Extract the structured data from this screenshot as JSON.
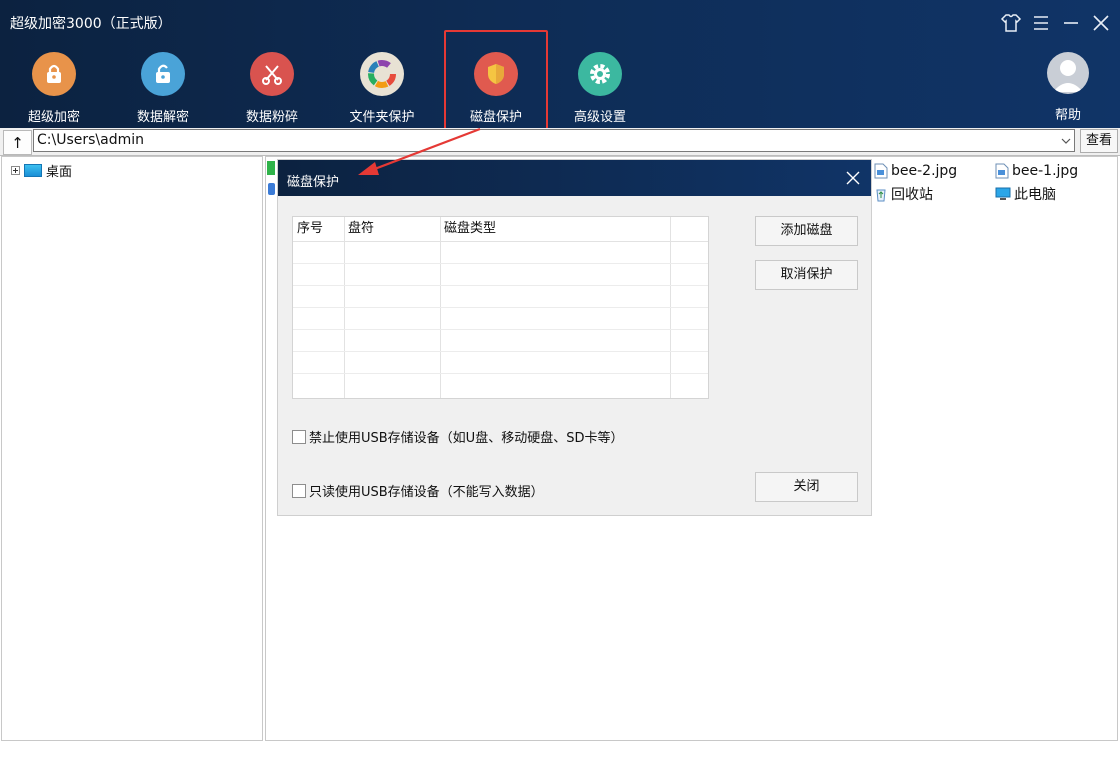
{
  "app": {
    "title": "超级加密3000（正式版）"
  },
  "toolbar": {
    "items": [
      {
        "label": "超级加密"
      },
      {
        "label": "数据解密"
      },
      {
        "label": "数据粉碎"
      },
      {
        "label": "文件夹保护"
      },
      {
        "label": "磁盘保护"
      },
      {
        "label": "高级设置"
      }
    ],
    "help_label": "帮助",
    "active": "磁盘保护"
  },
  "icons": {
    "encrypt": "lock-icon",
    "decrypt": "unlock-icon",
    "shred": "scissors-icon",
    "folder_protect": "color-wheel-icon",
    "disk_protect": "shield-icon",
    "settings": "gear-icon",
    "help": "avatar-icon"
  },
  "colors": {
    "header_bg": "#0e2c55",
    "highlight_border": "#e53935",
    "encrypt": "#e8934a",
    "decrypt": "#4aa3d8",
    "shred": "#d9534f",
    "folder_protect": "#e8e2d4",
    "disk_protect": "#e05a4f",
    "settings": "#3cb8a0"
  },
  "pathbar": {
    "up_label": "↑",
    "path": "C:\\Users\\admin",
    "view_label": "查看"
  },
  "tree": {
    "root_label": "桌面"
  },
  "files": [
    {
      "name": "bee-2.jpg",
      "icon": "image-file-icon"
    },
    {
      "name": "bee-1.jpg",
      "icon": "image-file-icon"
    },
    {
      "name": "回收站",
      "icon": "recycle-bin-icon"
    },
    {
      "name": "此电脑",
      "icon": "computer-icon"
    }
  ],
  "dialog": {
    "title": "磁盘保护",
    "columns": [
      "序号",
      "盘符",
      "磁盘类型"
    ],
    "add_label": "添加磁盘",
    "cancel_label": "取消保护",
    "close_label": "关闭",
    "option_block_usb": "禁止使用USB存储设备（如U盘、移动硬盘、SD卡等）",
    "option_readonly_usb": "只读使用USB存储设备（不能写入数据）",
    "block_usb_checked": false,
    "readonly_usb_checked": false
  }
}
